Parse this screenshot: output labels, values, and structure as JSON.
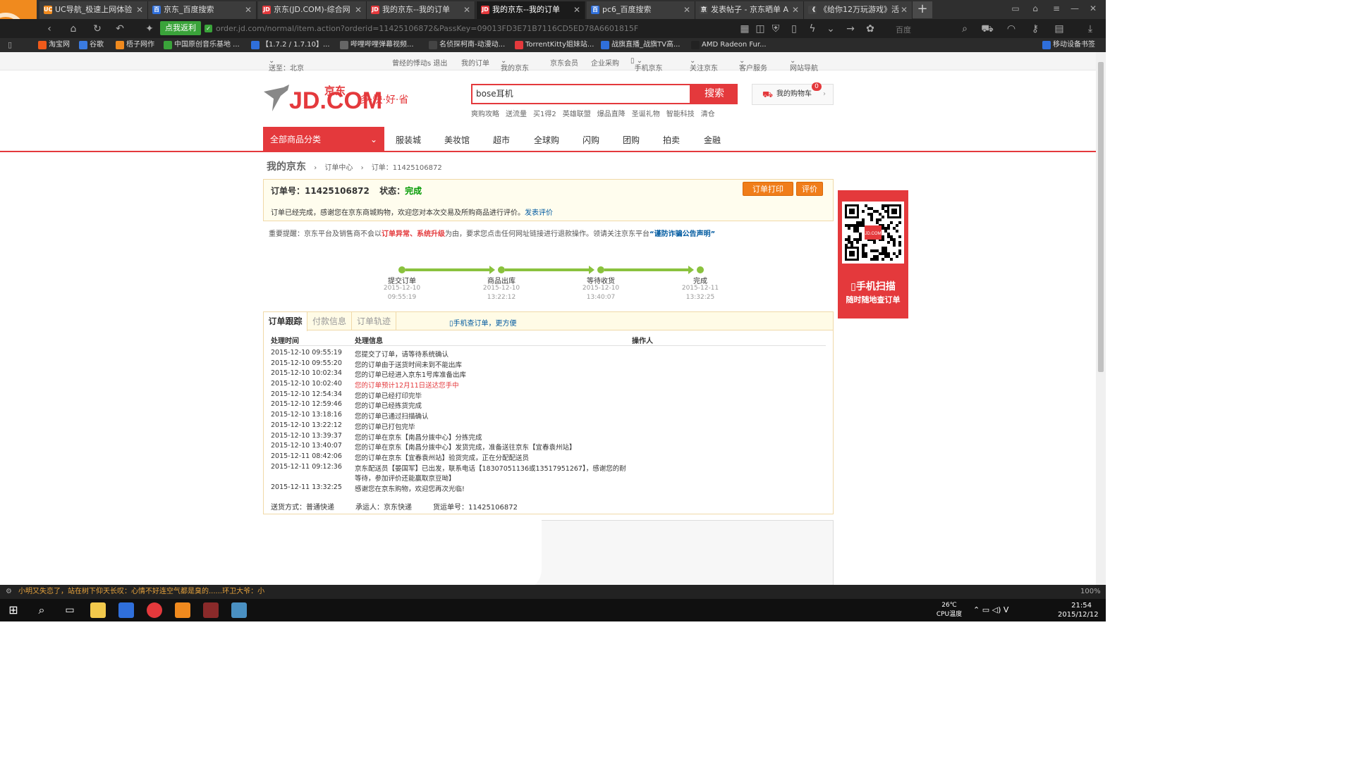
{
  "browser": {
    "tabs": [
      {
        "label": "UC导航_极速上网体验",
        "fav": "UC",
        "color": "#f08a1e",
        "active": false
      },
      {
        "label": "京东_百度搜索",
        "fav": "百",
        "color": "#2f6fdb",
        "active": false
      },
      {
        "label": "京东(JD.COM)-综合网",
        "fav": "JD",
        "color": "#e4393c",
        "active": false
      },
      {
        "label": "我的京东--我的订单",
        "fav": "JD",
        "color": "#e4393c",
        "active": false
      },
      {
        "label": "我的京东--我的订单",
        "fav": "JD",
        "color": "#e4393c",
        "active": true
      },
      {
        "label": "pc6_百度搜索",
        "fav": "百",
        "color": "#2f6fdb",
        "active": false
      },
      {
        "label": "发表帖子 - 京东晒单 A",
        "fav": "京",
        "color": "#444",
        "active": false
      },
      {
        "label": "《给你12万玩游戏》活",
        "fav": "《",
        "color": "#444",
        "active": false
      }
    ],
    "fanli_label": "点我返利",
    "url": "order.jd.com/normal/item.action?orderid=11425106872&PassKey=09013FD3E71B7116CD5ED78A6601815F",
    "search_engine": "百度",
    "bookmarks": [
      {
        "label": "淘宝网",
        "color": "#f05a1a"
      },
      {
        "label": "谷歌",
        "color": "#3a7be0"
      },
      {
        "label": "梧子网作",
        "color": "#f08a1e"
      },
      {
        "label": "中国原创音乐基地 ...",
        "color": "#3aa33a"
      },
      {
        "label": "【1.7.2 / 1.7.10】...",
        "color": "#2f6fdb"
      },
      {
        "label": "哔哩哔哩弹幕视频...",
        "color": "#666"
      },
      {
        "label": "名侦探柯南-动漫动...",
        "color": "#444"
      },
      {
        "label": "TorrentKitty姐妹站...",
        "color": "#e4393c"
      },
      {
        "label": "战旗直播_战旗TV高...",
        "color": "#2f6fdb"
      },
      {
        "label": "AMD Radeon Fur...",
        "color": "#222"
      }
    ],
    "mobile_bookmarks": "移动设备书签",
    "zoom": "100%"
  },
  "site": {
    "location": "送至：北京",
    "shortcut": [
      "曾经的悸动s  退出",
      "我的订单",
      "我的京东",
      "京东会员",
      "企业采购",
      "手机京东",
      "关注京东",
      "客户服务",
      "网站导航"
    ],
    "logo_text": "JD.COM",
    "logo_cn": "京东",
    "slogan": "多·快·好·省",
    "search_value": "bose耳机",
    "search_btn": "搜索",
    "hotwords": [
      "爽购攻略",
      "送流量",
      "买1得2",
      "英雄联盟",
      "爆品直降",
      "圣诞礼物",
      "智能科技",
      "清仓"
    ],
    "cart_label": "我的购物车",
    "cart_count": "0",
    "all_categories": "全部商品分类",
    "nav": [
      "服装城",
      "美妆馆",
      "超市",
      "全球购",
      "闪购",
      "团购",
      "拍卖",
      "金融"
    ]
  },
  "breadcrumb": {
    "root": "我的京东",
    "mid": "订单中心",
    "leaf": "订单：11425106872"
  },
  "order": {
    "label_no": "订单号：",
    "no": "11425106872",
    "label_status": "状态：",
    "status": "完成",
    "print_btn": "订单打印",
    "review_btn": "评价",
    "desc": "订单已经完成，感谢您在京东商城购物，欢迎您对本次交易及所购商品进行评价。",
    "desc_link": "发表评价"
  },
  "warning": {
    "pre": "重要提醒：京东平台及销售商不会以",
    "red": "订单异常、系统升级",
    "mid": "为由，要求您点击任何网址链接进行退款操作。领请关注京东平台",
    "link": "“谨防诈骗公告声明”"
  },
  "progress": [
    {
      "label": "提交订单",
      "date": "2015-12-10",
      "time": "09:55:19"
    },
    {
      "label": "商品出库",
      "date": "2015-12-10",
      "time": "13:22:12"
    },
    {
      "label": "等待收货",
      "date": "2015-12-10",
      "time": "13:40:07"
    },
    {
      "label": "完成",
      "date": "2015-12-11",
      "time": "13:32:25"
    }
  ],
  "tracking": {
    "tabs": [
      "订单跟踪",
      "付款信息",
      "订单轨迹"
    ],
    "mobile_link": "手机查订单，更方便",
    "col_time": "处理时间",
    "col_info": "处理信息",
    "col_op": "操作人",
    "rows": [
      {
        "t": "2015-12-10 09:55:19",
        "i": "您提交了订单，请等待系统确认"
      },
      {
        "t": "2015-12-10 09:55:20",
        "i": "您的订单由于送货时间未到不能出库"
      },
      {
        "t": "2015-12-10 10:02:34",
        "i": "您的订单已经进入京东1号库准备出库"
      },
      {
        "t": "2015-12-10 10:02:40",
        "i": "您的订单预计12月11日送达您手中",
        "red": true
      },
      {
        "t": "2015-12-10 12:54:34",
        "i": "您的订单已经打印完毕"
      },
      {
        "t": "2015-12-10 12:59:46",
        "i": "您的订单已经拣货完成"
      },
      {
        "t": "2015-12-10 13:18:16",
        "i": "您的订单已通过扫描确认"
      },
      {
        "t": "2015-12-10 13:22:12",
        "i": "您的订单已打包完毕"
      },
      {
        "t": "2015-12-10 13:39:37",
        "i": "您的订单在京东【南昌分拨中心】分拣完成"
      },
      {
        "t": "2015-12-10 13:40:07",
        "i": "您的订单在京东【南昌分拨中心】发货完成，准备送往京东【宜春袁州站】"
      },
      {
        "t": "2015-12-11 08:42:06",
        "i": "您的订单在京东【宜春袁州站】验货完成，正在分配配送员"
      },
      {
        "t": "2015-12-11 09:12:36",
        "i": "京东配送员【晏国军】已出发，联系电话【18307051136或13517951267】，感谢您的耐"
      },
      {
        "t": "",
        "i": "等待，参加评价还能赢取京豆呦】"
      },
      {
        "t": "2015-12-11 13:32:25",
        "i": "感谢您在京东购物，欢迎您再次光临!"
      }
    ],
    "footer": "送货方式：普通快递　　　承运人：京东快递　　　货运单号：11425106872"
  },
  "qr": {
    "title": "手机扫描",
    "subtitle": "随时随地查订单",
    "inner": "JD.COM"
  },
  "statusbar": {
    "news": "小明又失恋了，站在树下仰天长叹：心情不好连空气都是臭的......环卫大爷：小"
  },
  "taskbar": {
    "temp": "26℃",
    "temp_label": "CPU温度",
    "time": "21:54",
    "date": "2015/12/12"
  }
}
